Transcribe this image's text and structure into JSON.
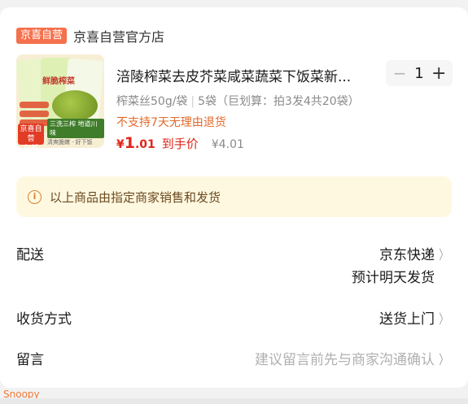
{
  "store": {
    "badge": "京喜自营",
    "name": "京喜自营官方店"
  },
  "product": {
    "thumb": {
      "pack_title": "鲜脆榨菜",
      "badge_line1": "京喜自营",
      "badge_line2": "包邮",
      "slogan": "三洗三榨 地道川味",
      "footer": "清爽脆嫩 · 好下饭"
    },
    "title": "涪陵榨菜去皮芥菜咸菜蔬菜下饭菜新...",
    "spec_main": "榨菜丝50g/袋",
    "spec_sep": "|",
    "spec_extra": "5袋（巨划算：拍3发4共20袋）",
    "no_return": "不支持7天无理由退货",
    "price": {
      "symbol": "¥",
      "int": "1",
      "dec": ".01",
      "label": "到手价",
      "original": "¥4.01"
    },
    "quantity": {
      "minus": "−",
      "value": "1",
      "plus": "+"
    }
  },
  "notice": {
    "icon": "info-icon",
    "text": "以上商品由指定商家销售和发货"
  },
  "delivery": {
    "label": "配送",
    "method": "京东快递",
    "eta": "预计明天发货"
  },
  "receive": {
    "label": "收货方式",
    "value": "送货上门"
  },
  "message": {
    "label": "留言",
    "placeholder": "建议留言前先与商家沟通确认"
  },
  "chevron_glyph": "〉",
  "watermark": "Snoopy",
  "colors": {
    "accent_red": "#e1251b",
    "badge_orange": "#f5704d",
    "notice_bg": "#fff8e1",
    "warn_orange": "#e26a2c"
  }
}
